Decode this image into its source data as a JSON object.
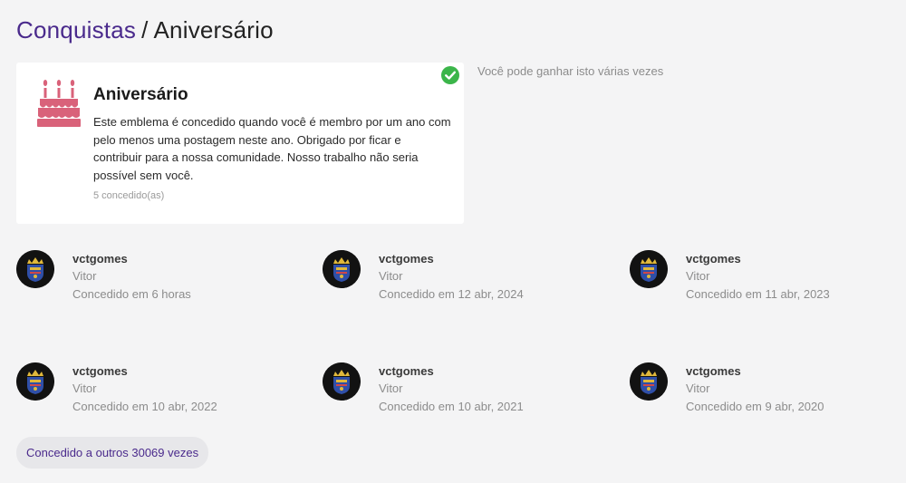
{
  "breadcrumb": {
    "parent": "Conquistas",
    "separator": "/",
    "current": "Aniversário"
  },
  "badge": {
    "title": "Aniversário",
    "description": "Este emblema é concedido quando você é membro por um ano com pelo menos uma postagem neste ano. Obrigado por ficar e contribuir para a nossa comunidade. Nosso trabalho não seria possível sem você.",
    "count_text": "5 concedido(as)",
    "icon": "birthday-cake-icon",
    "owned_icon": "check-circle-icon"
  },
  "multi_note": "Você pode ganhar isto várias vezes",
  "grants": [
    {
      "username": "vctgomes",
      "name": "Vitor",
      "date": "Concedido em 6 horas"
    },
    {
      "username": "vctgomes",
      "name": "Vitor",
      "date": "Concedido em 12 abr, 2024"
    },
    {
      "username": "vctgomes",
      "name": "Vitor",
      "date": "Concedido em 11 abr, 2023"
    },
    {
      "username": "vctgomes",
      "name": "Vitor",
      "date": "Concedido em 10 abr, 2022"
    },
    {
      "username": "vctgomes",
      "name": "Vitor",
      "date": "Concedido em 10 abr, 2021"
    },
    {
      "username": "vctgomes",
      "name": "Vitor",
      "date": "Concedido em 9 abr, 2020"
    }
  ],
  "granted_others": "Concedido a outros 30069 vezes",
  "colors": {
    "accent": "#4a2a8c",
    "cake": "#d9627a",
    "check": "#3bb54a",
    "background": "#f4f4f5"
  }
}
